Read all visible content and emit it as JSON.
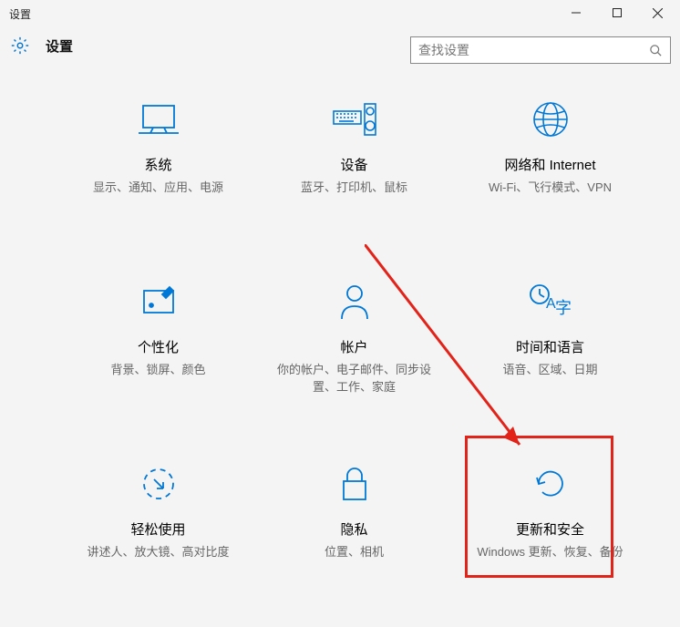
{
  "window": {
    "title": "设置"
  },
  "header": {
    "title": "设置"
  },
  "search": {
    "placeholder": "查找设置"
  },
  "items": [
    {
      "title": "系统",
      "desc": "显示、通知、应用、电源"
    },
    {
      "title": "设备",
      "desc": "蓝牙、打印机、鼠标"
    },
    {
      "title": "网络和 Internet",
      "desc": "Wi-Fi、飞行模式、VPN"
    },
    {
      "title": "个性化",
      "desc": "背景、锁屏、颜色"
    },
    {
      "title": "帐户",
      "desc": "你的帐户、电子邮件、同步设置、工作、家庭"
    },
    {
      "title": "时间和语言",
      "desc": "语音、区域、日期"
    },
    {
      "title": "轻松使用",
      "desc": "讲述人、放大镜、高对比度"
    },
    {
      "title": "隐私",
      "desc": "位置、相机"
    },
    {
      "title": "更新和安全",
      "desc": "Windows 更新、恢复、备份"
    }
  ]
}
